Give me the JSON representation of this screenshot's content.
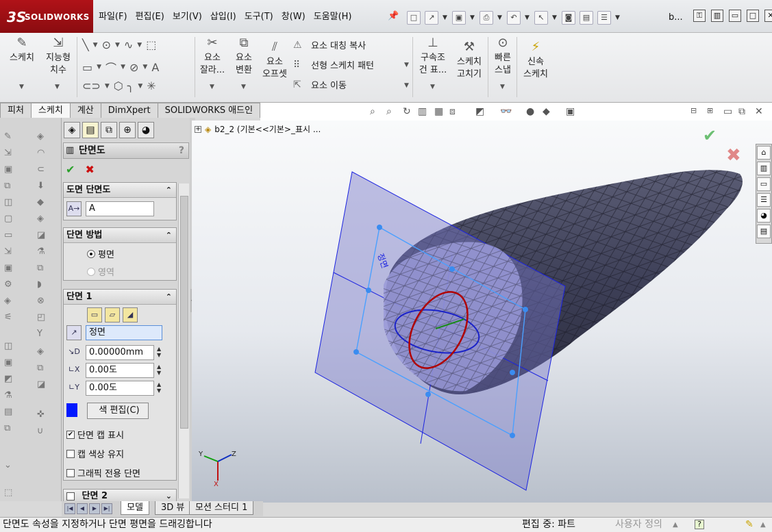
{
  "app": {
    "brand_ds": "3S",
    "brand_name": "SOLIDWORKS",
    "doc_title": "b..."
  },
  "menus": [
    "파일(F)",
    "편집(E)",
    "보기(V)",
    "삽입(I)",
    "도구(T)",
    "창(W)",
    "도움말(H)"
  ],
  "ribbon": {
    "sketch": "스케치",
    "smart_dim_1": "지능형",
    "smart_dim_2": "치수",
    "trim_1": "요소",
    "trim_2": "잘라...",
    "convert_1": "요소",
    "convert_2": "변환",
    "offset_1": "요소",
    "offset_2": "오프셋",
    "mirror": "요소 대칭 복사",
    "linear_pattern": "선형 스케치 패턴",
    "move": "요소 이동",
    "relations_1": "구속조",
    "relations_2": "건 표...",
    "repair_1": "스케치",
    "repair_2": "고치기",
    "quick_snaps_1": "빠른",
    "quick_snaps_2": "스냅",
    "rapid_sketch_1": "신속",
    "rapid_sketch_2": "스케치"
  },
  "tabs": [
    "피처",
    "스케치",
    "계산",
    "DimXpert",
    "SOLIDWORKS 애드인"
  ],
  "tree": {
    "label": "b2_2  (기본<<기본>_표시 ..."
  },
  "pm": {
    "title": "단면도",
    "help": "?",
    "group_drawing": "도면 단면도",
    "name_value": "A",
    "group_method": "단면 방법",
    "radio_planar": "평면",
    "radio_zonal": "영역",
    "group_section1": "단면 1",
    "ref_plane": "정면",
    "offset_value": "0.00000mm",
    "angle_x": "0.00도",
    "angle_y": "0.00도",
    "edit_color": "색 편집(C)",
    "chk_show_cap": "단면 캡 표시",
    "chk_keep_cap_color": "캡 색상 유지",
    "chk_graphics_only": "그래픽 전용 단면",
    "group_section2": "단면 2"
  },
  "bottom_tabs": [
    "모델",
    "3D 뷰",
    "모션 스터디 1"
  ],
  "status": {
    "message": "단면도 속성을 지정하거나 단면 평면을 드래깅합니다",
    "editing": "편집 중: 파트",
    "custom": "사용자 정의"
  },
  "triad": {
    "x": "X",
    "y": "Y",
    "z": "Z"
  },
  "plane_label": "정면",
  "colors": {
    "section_swatch": "#0018ff",
    "brand_red": "#b01218",
    "plane": "#7878c8"
  },
  "icons": {
    "ok": "check-icon",
    "cancel": "close-icon"
  }
}
